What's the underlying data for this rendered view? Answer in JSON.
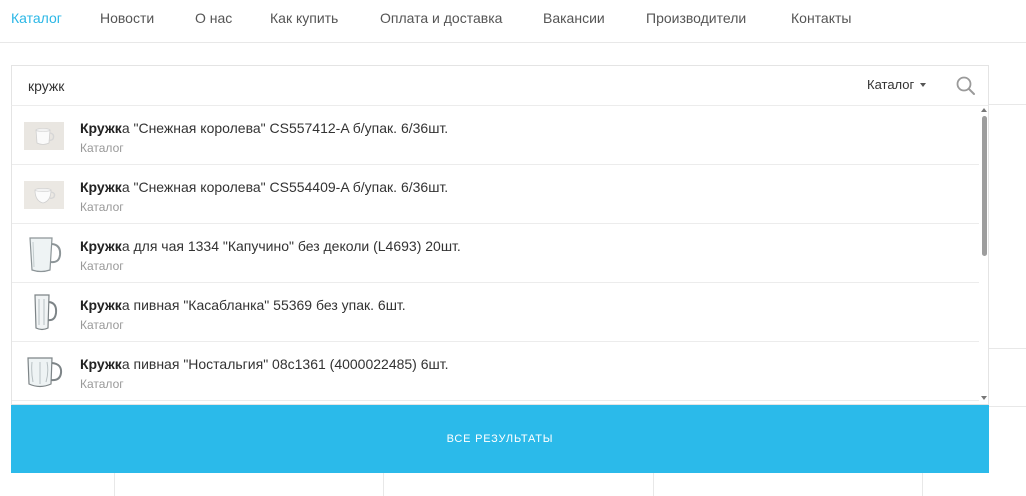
{
  "nav": {
    "items": [
      {
        "label": "Каталог",
        "active": true
      },
      {
        "label": "Новости"
      },
      {
        "label": "О нас"
      },
      {
        "label": "Как купить"
      },
      {
        "label": "Оплата и доставка"
      },
      {
        "label": "Вакансии"
      },
      {
        "label": "Производители"
      },
      {
        "label": "Контакты"
      }
    ]
  },
  "search": {
    "value": "кружк",
    "scope_label": "Каталог",
    "search_icon": "search-icon"
  },
  "results": [
    {
      "highlight": "Кружк",
      "rest": "а \"Снежная королева\" CS557412-A б/упак. 6/36шт.",
      "category": "Каталог",
      "thumb": "cup-white"
    },
    {
      "highlight": "Кружк",
      "rest": "а \"Снежная королева\" CS554409-A б/упак. 6/36шт.",
      "category": "Каталог",
      "thumb": "cup-white"
    },
    {
      "highlight": "Кружк",
      "rest": "а для чая 1334 \"Капучино\" без деколи (L4693) 20шт.",
      "category": "Каталог",
      "thumb": "glass-mug"
    },
    {
      "highlight": "Кружк",
      "rest": "а пивная \"Касабланка\" 55369 без упак. 6шт.",
      "category": "Каталог",
      "thumb": "beer-mug-tall"
    },
    {
      "highlight": "Кружк",
      "rest": "а пивная \"Ностальгия\" 08с1361 (4000022485) 6шт.",
      "category": "Каталог",
      "thumb": "beer-mug"
    }
  ],
  "all_results_label": "ВСЕ РЕЗУЛЬТАТЫ",
  "colors": {
    "accent": "#2bbaea",
    "nav_active": "#2bb7e6"
  }
}
